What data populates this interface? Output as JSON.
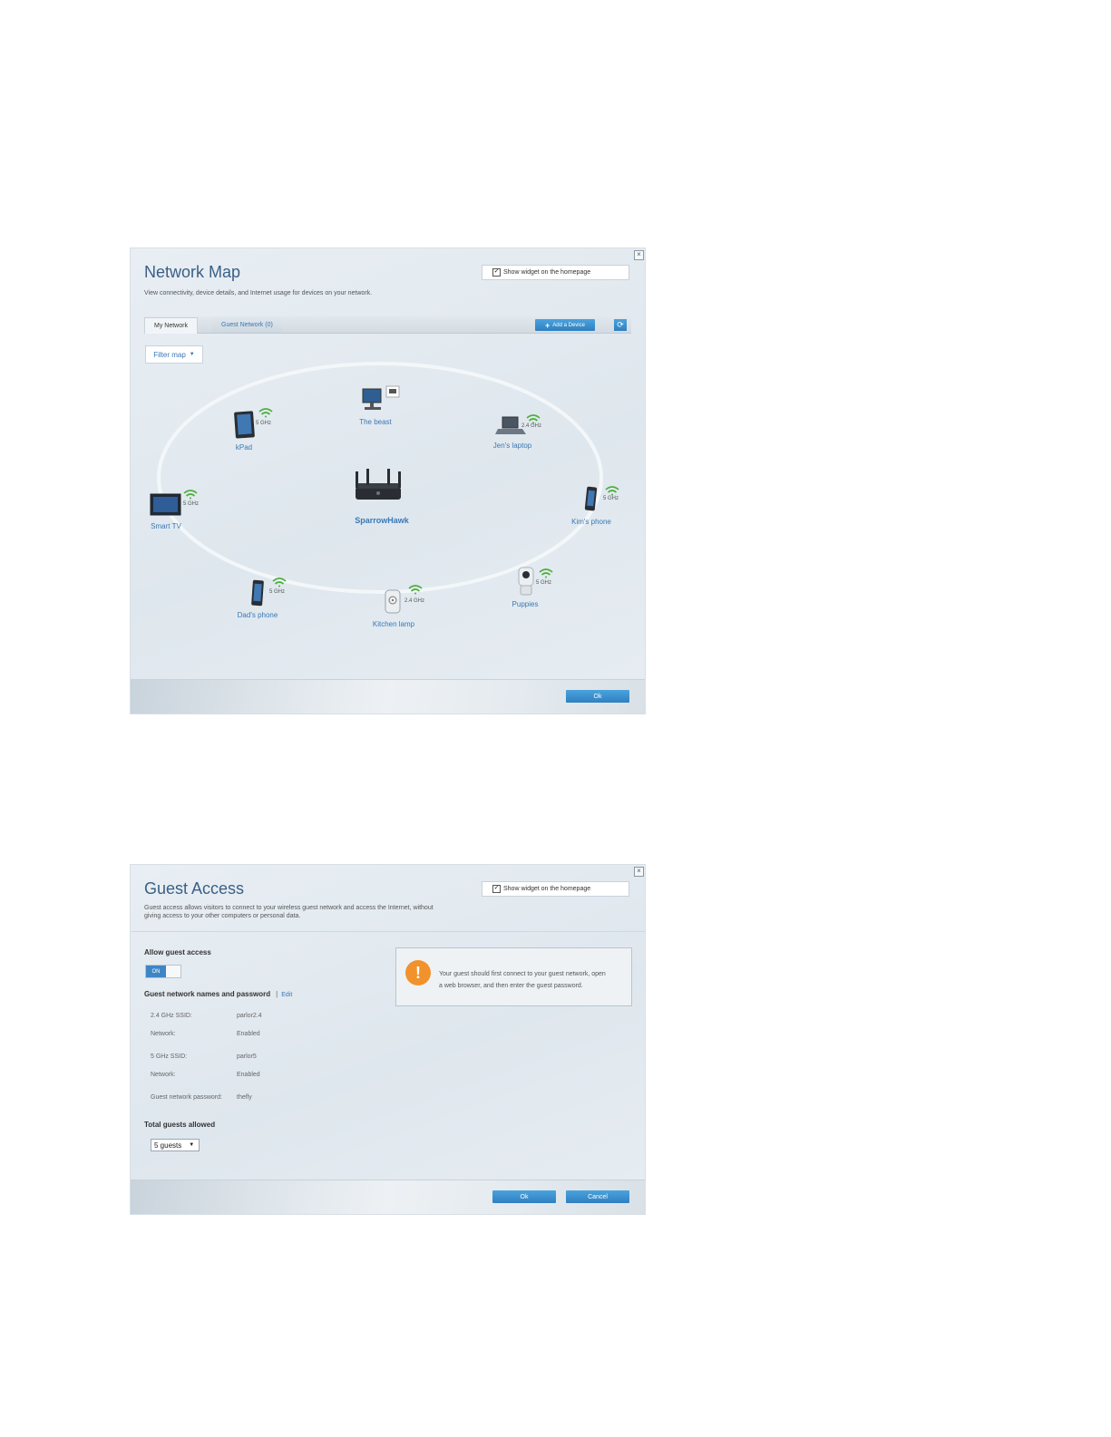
{
  "network_map": {
    "title": "Network Map",
    "subtitle": "View connectivity, device details, and Internet usage for devices on your network.",
    "widget_checkbox_label": "Show widget on the homepage",
    "widget_checked": true,
    "tabs": [
      {
        "label": "My Network",
        "active": true
      },
      {
        "label": "Guest Network (0)",
        "active": false
      }
    ],
    "add_device_label": "Add a Device",
    "filter_label": "Filter map",
    "router_name": "SparrowHawk",
    "devices": [
      {
        "name": "The beast",
        "type": "desktop",
        "band": ""
      },
      {
        "name": "Jen's laptop",
        "type": "laptop",
        "band": "2.4 GHz"
      },
      {
        "name": "Kim's phone",
        "type": "phone",
        "band": "5 GHz"
      },
      {
        "name": "Puppies",
        "type": "camera",
        "band": "5 GHz"
      },
      {
        "name": "Kitchen lamp",
        "type": "plug",
        "band": "2.4 GHz"
      },
      {
        "name": "Dad's phone",
        "type": "phone",
        "band": "5 GHz"
      },
      {
        "name": "Smart TV",
        "type": "tv",
        "band": "5 GHz"
      },
      {
        "name": "kPad",
        "type": "tablet",
        "band": "5 GHz"
      }
    ],
    "ok_label": "Ok"
  },
  "guest_access": {
    "title": "Guest Access",
    "subtitle_line1": "Guest access allows visitors to connect to your wireless guest network and access the Internet, without",
    "subtitle_line2": "giving access to your other computers or personal data.",
    "widget_checkbox_label": "Show widget on the homepage",
    "widget_checked": true,
    "allow_heading": "Allow guest access",
    "toggle_label": "ON",
    "names_heading": "Guest network names and password",
    "edit_label": "Edit",
    "fields": [
      {
        "key": "2.4 GHz SSID:",
        "value": "parlor2.4"
      },
      {
        "key": "Network:",
        "value": "Enabled"
      },
      {
        "key": "5 GHz SSID:",
        "value": "parlor5"
      },
      {
        "key": "Network:",
        "value": "Enabled"
      },
      {
        "key": "Guest network password:",
        "value": "thefly"
      }
    ],
    "total_heading": "Total guests allowed",
    "total_selected": "5 guests",
    "info_line1": "Your guest should first connect to your guest network, open",
    "info_line2": "a web browser, and then enter the guest password.",
    "ok_label": "Ok",
    "cancel_label": "Cancel"
  },
  "colors": {
    "accent": "#3a78b5",
    "button": "#2f7fc0",
    "wifi": "#4cae3c",
    "warning": "#f2922c"
  }
}
